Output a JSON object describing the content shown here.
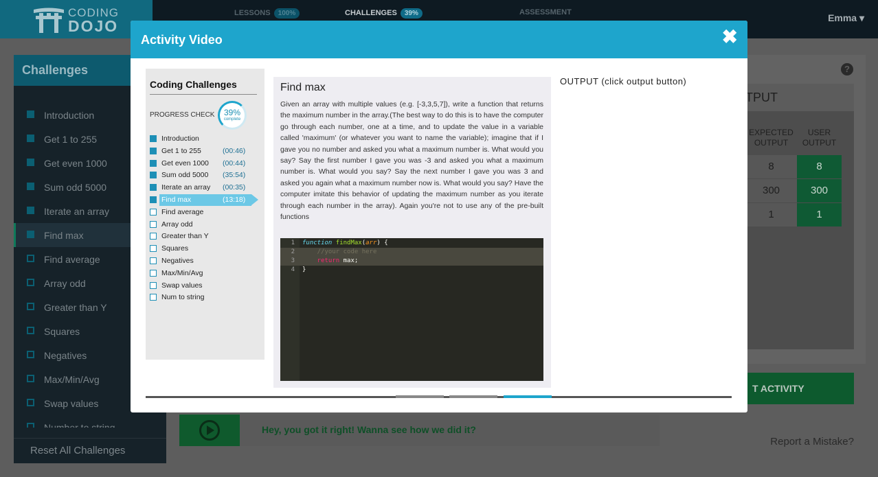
{
  "header": {
    "logo": {
      "line1": "CODING",
      "line2": "DOJO"
    },
    "nav": [
      {
        "label": "LESSONS",
        "percent": "100%"
      },
      {
        "label": "CHALLENGES",
        "percent": "39%"
      },
      {
        "label": "ASSESSMENT"
      }
    ],
    "user": "Emma ▾"
  },
  "sidebar": {
    "title": "Challenges",
    "items": [
      {
        "label": "Introduction",
        "done": true
      },
      {
        "label": "Get 1 to 255",
        "done": true
      },
      {
        "label": "Get even 1000",
        "done": true
      },
      {
        "label": "Sum odd 5000",
        "done": true
      },
      {
        "label": "Iterate an array",
        "done": true
      },
      {
        "label": "Find max",
        "done": true,
        "current": true
      },
      {
        "label": "Find average",
        "done": false
      },
      {
        "label": "Array odd",
        "done": false
      },
      {
        "label": "Greater than Y",
        "done": false
      },
      {
        "label": "Squares",
        "done": false
      },
      {
        "label": "Negatives",
        "done": false
      },
      {
        "label": "Max/Min/Avg",
        "done": false
      },
      {
        "label": "Swap values",
        "done": false
      },
      {
        "label": "Number to string",
        "done": false
      }
    ],
    "reset_label": "Reset All Challenges"
  },
  "output_panel": {
    "title": "TPUT",
    "headers": {
      "expected": "EXPECTED OUTPUT",
      "user": "USER OUTPUT"
    },
    "rows": [
      {
        "expected": "8",
        "user": "8"
      },
      {
        "expected": "300",
        "user": "300"
      },
      {
        "expected": "1",
        "user": "1"
      }
    ],
    "activity_button": "T ACTIVITY",
    "report_link": "Report a Mistake?"
  },
  "hint": {
    "text": "Hey, you got it right! Wanna see how we did it?"
  },
  "modal": {
    "title": "Activity Video",
    "close_icon": "✖",
    "video": {
      "sidebar_title": "Coding Challenges",
      "progress_label": "PROGRESS CHECK",
      "progress_percent": "39%",
      "progress_complete": "complete",
      "items": [
        {
          "label": "Introduction",
          "time": "",
          "done": true
        },
        {
          "label": "Get 1 to 255",
          "time": "(00:46)",
          "done": true
        },
        {
          "label": "Get even 1000",
          "time": "(00:44)",
          "done": true
        },
        {
          "label": "Sum odd 5000",
          "time": "(35:54)",
          "done": true
        },
        {
          "label": "Iterate an array",
          "time": "(00:35)",
          "done": true
        },
        {
          "label": "Find max",
          "time": "(13:18)",
          "done": true,
          "current": true
        },
        {
          "label": "Find average",
          "time": "",
          "done": false
        },
        {
          "label": "Array odd",
          "time": "",
          "done": false
        },
        {
          "label": "Greater than Y",
          "time": "",
          "done": false
        },
        {
          "label": "Squares",
          "time": "",
          "done": false
        },
        {
          "label": "Negatives",
          "time": "",
          "done": false
        },
        {
          "label": "Max/Min/Avg",
          "time": "",
          "done": false
        },
        {
          "label": "Swap values",
          "time": "",
          "done": false
        },
        {
          "label": "Num to string",
          "time": "",
          "done": false
        }
      ],
      "problem_title": "Find max",
      "problem_text": "Given an array with multiple values (e.g. [-3,3,5,7]), write a function that returns the maximum number in the array.(The best way to do this is to have the computer go through each number, one at a time, and to update the value in a variable called 'maximum' (or whatever you want to name the variable); imagine that if I gave you no number and asked you what a maximum number is. What would you say? Say the first number I gave you was -3 and asked you what a maximum number is. What would you say? Say the next number I gave you was 3 and asked you again what a maximum number now is. What would you say? Have the computer imitate this behavior of updating the maximum number as you iterate through each number in the array). Again you're not to use any of the pre-built functions",
      "code_lines": [
        {
          "num": "1",
          "parts": [
            [
              "kw",
              "function "
            ],
            [
              "fn",
              "findMax"
            ],
            [
              "",
              "("
            ],
            [
              "arg",
              "arr"
            ],
            [
              "",
              ") {"
            ]
          ]
        },
        {
          "num": "2",
          "parts": [
            [
              "cm",
              "    //your code here"
            ]
          ]
        },
        {
          "num": "3",
          "parts": [
            [
              "ret",
              "    return "
            ],
            [
              "",
              "max;"
            ]
          ]
        },
        {
          "num": "4",
          "parts": [
            [
              "",
              "}"
            ]
          ]
        }
      ],
      "output_label": "OUTPUT (click output button)"
    }
  }
}
